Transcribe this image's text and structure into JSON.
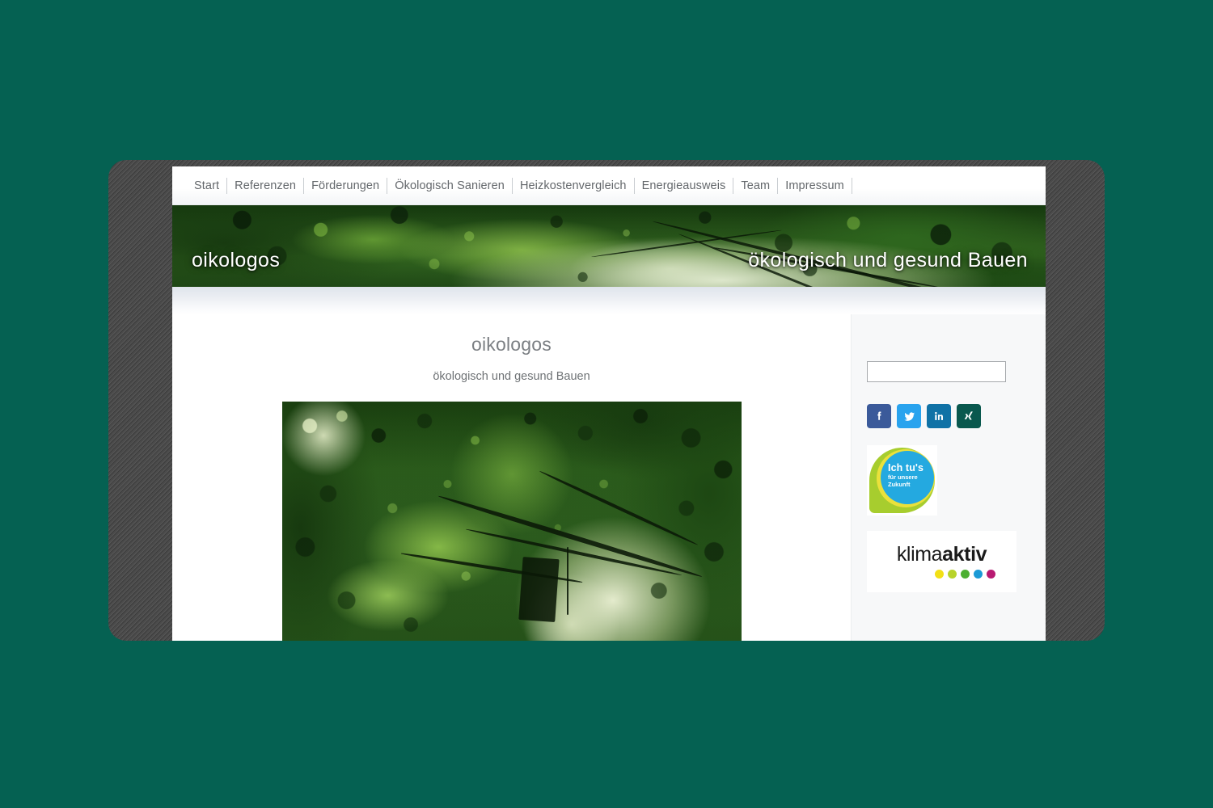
{
  "theme": {
    "page_background": "#056152",
    "frame_color": "#474747",
    "accent_green": "#a7cd2e",
    "accent_blue": "#24a9e0"
  },
  "nav": {
    "items": [
      {
        "label": "Start"
      },
      {
        "label": "Referenzen"
      },
      {
        "label": "Förderungen"
      },
      {
        "label": "Ökologisch Sanieren"
      },
      {
        "label": "Heizkostenvergleich"
      },
      {
        "label": "Energieausweis"
      },
      {
        "label": "Team"
      },
      {
        "label": "Impressum"
      }
    ]
  },
  "banner": {
    "title": "oikologos",
    "tagline": "ökologisch und gesund Bauen",
    "image_alt": "forest-river-panorama"
  },
  "main": {
    "title": "oikologos",
    "subtitle": "ökologisch und gesund Bauen",
    "hero_image_alt": "sunlit-forest-stream-photo"
  },
  "sidebar": {
    "search": {
      "value": "",
      "placeholder": ""
    },
    "social": [
      {
        "name": "facebook",
        "glyph": "f",
        "color": "#3b5a9a"
      },
      {
        "name": "twitter",
        "glyph": "t",
        "color": "#29a3ee"
      },
      {
        "name": "linkedin",
        "glyph": "in",
        "color": "#1072a6"
      },
      {
        "name": "xing",
        "glyph": "X",
        "color": "#09584e"
      }
    ],
    "ichtus_logo": {
      "line1": "Ich tu's",
      "line2": "für unsere",
      "line3": "Zukunft"
    },
    "klima_logo": {
      "light_part": "klima",
      "bold_part": "aktiv",
      "dots": [
        "#f2e016",
        "#b8d32a",
        "#4caf32",
        "#1b9ad6",
        "#b81a72"
      ]
    }
  }
}
